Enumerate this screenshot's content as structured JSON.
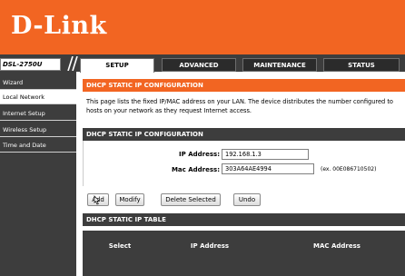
{
  "brand": {
    "logo_text": "D-Link",
    "model": "DSL-2750U",
    "orange": "#f26522",
    "dark": "#3d3d3d"
  },
  "tabs": [
    {
      "label": "SETUP",
      "active": true
    },
    {
      "label": "ADVANCED",
      "active": false
    },
    {
      "label": "MAINTENANCE",
      "active": false
    },
    {
      "label": "STATUS",
      "active": false
    }
  ],
  "sidebar": {
    "items": [
      {
        "label": "Wizard",
        "active": false
      },
      {
        "label": "Local Network",
        "active": true
      },
      {
        "label": "Internet Setup",
        "active": false
      },
      {
        "label": "Wireless Setup",
        "active": false
      },
      {
        "label": "Time and Date",
        "active": false
      }
    ]
  },
  "config_section": {
    "title": "DHCP STATIC IP CONFIGURATION",
    "description": "This page lists the fixed IP/MAC address on your LAN. The device distributes the number configured to hosts on your network as they request Internet access."
  },
  "form_section": {
    "title": "DHCP STATIC IP CONFIGURATION",
    "ip_label": "IP Address:",
    "ip_value": "192.168.1.3",
    "mac_label": "Mac Address:",
    "mac_value": "303A64AE4994",
    "mac_example": "(ex. 00E086710502)"
  },
  "buttons": {
    "add": "Add",
    "modify": "Modify",
    "delete_selected": "Delete Selected",
    "undo": "Undo"
  },
  "table": {
    "title": "DHCP STATIC IP TABLE",
    "columns": [
      "Select",
      "IP Address",
      "MAC Address"
    ]
  }
}
